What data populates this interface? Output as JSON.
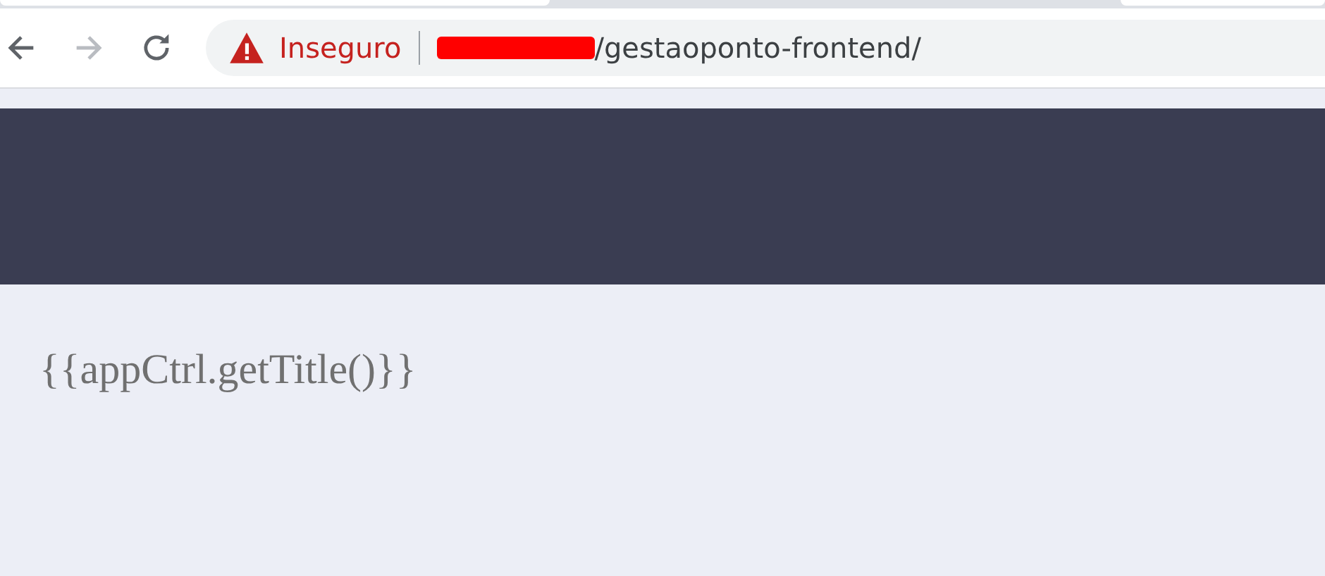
{
  "toolbar": {
    "buttons": [
      {
        "kind": "back",
        "disabled": false
      },
      {
        "kind": "forward",
        "disabled": true
      },
      {
        "kind": "reload",
        "disabled": false
      }
    ]
  },
  "address_bar": {
    "security_label": "Inseguro",
    "url": "/gestaoponto-frontend/"
  },
  "page": {
    "title": "{{appCtrl.getTitle()}}"
  }
}
